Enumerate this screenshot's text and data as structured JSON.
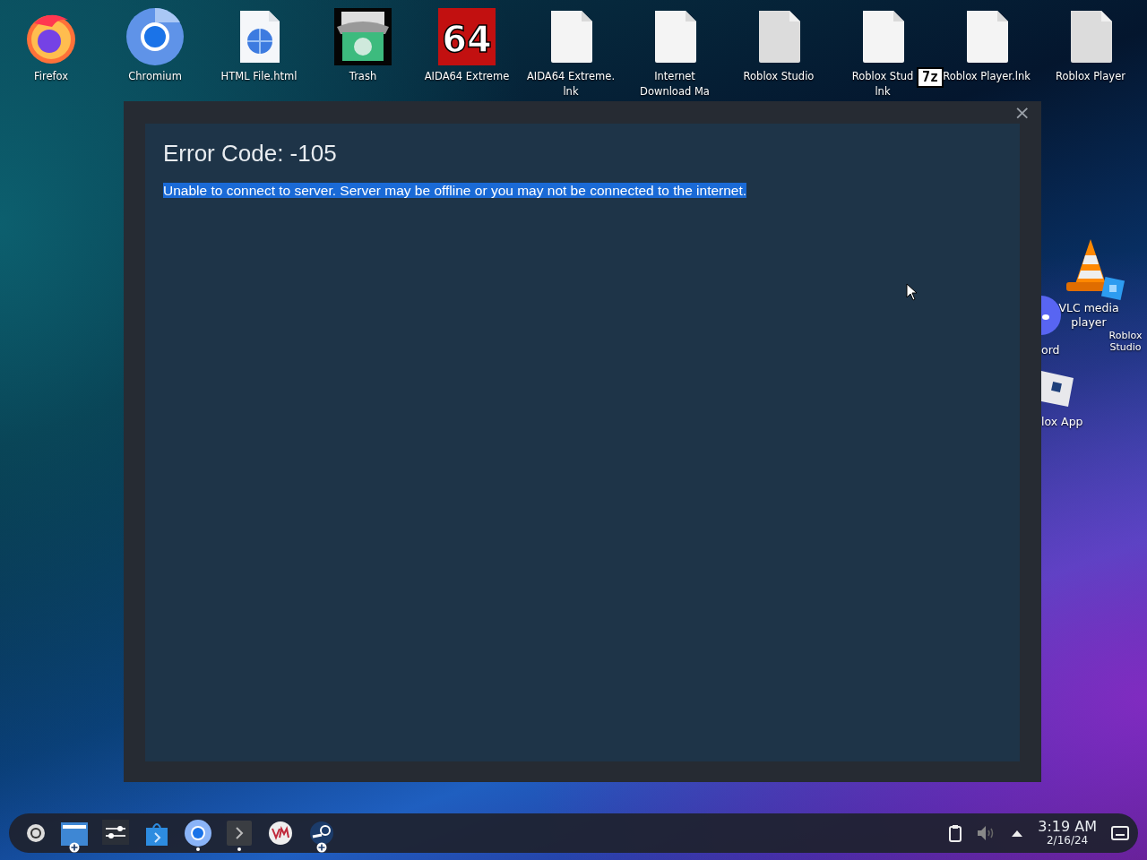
{
  "desktop_icons": [
    {
      "kind": "firefox",
      "label_lines": [
        "Firefox"
      ]
    },
    {
      "kind": "chromium",
      "label_lines": [
        "Chromium"
      ]
    },
    {
      "kind": "html",
      "label_lines": [
        "HTML File.html"
      ]
    },
    {
      "kind": "trash",
      "label_lines": [
        "Trash"
      ]
    },
    {
      "kind": "aida",
      "label_lines": [
        "AIDA64 Extreme"
      ],
      "icon_text": "64"
    },
    {
      "kind": "file",
      "label_lines": [
        "AIDA64 Extreme.",
        "lnk"
      ]
    },
    {
      "kind": "file",
      "label_lines": [
        "Internet",
        "Download Ma"
      ]
    },
    {
      "kind": "file-grey",
      "label_lines": [
        "Roblox Studio"
      ]
    },
    {
      "kind": "file",
      "label_lines": [
        "Roblox Stud",
        "lnk"
      ]
    },
    {
      "kind": "file",
      "label_lines": [
        "Roblox Player.lnk"
      ]
    },
    {
      "kind": "file-grey",
      "label_lines": [
        "Roblox Player"
      ]
    }
  ],
  "dragged_icon": {
    "text": "7z"
  },
  "side_icons": [
    {
      "kind": "vlc",
      "label": "VLC media player"
    },
    {
      "kind": "roblox-studio",
      "label": "Roblox Studio"
    },
    {
      "kind": "discord",
      "label": "ord"
    },
    {
      "kind": "roblox-app",
      "label": "lox App"
    }
  ],
  "dialog": {
    "close": "×",
    "title": "Error Code: -105",
    "message": "Unable to connect to server. Server may be offline or you may not be connected to the internet.",
    "message_selected": true
  },
  "taskbar": {
    "apps": [
      {
        "kind": "launcher",
        "running": false,
        "plus_badge": false
      },
      {
        "kind": "files",
        "running": false,
        "plus_badge": true
      },
      {
        "kind": "settings",
        "running": false,
        "plus_badge": false
      },
      {
        "kind": "store",
        "running": false,
        "plus_badge": false
      },
      {
        "kind": "chromium",
        "running": true,
        "plus_badge": false
      },
      {
        "kind": "terminal",
        "running": true,
        "plus_badge": false
      },
      {
        "kind": "vm",
        "running": false,
        "plus_badge": false
      },
      {
        "kind": "steam",
        "running": false,
        "plus_badge": true
      }
    ],
    "volume_muted": true,
    "time": "3:19 AM",
    "date": "2/16/24"
  }
}
